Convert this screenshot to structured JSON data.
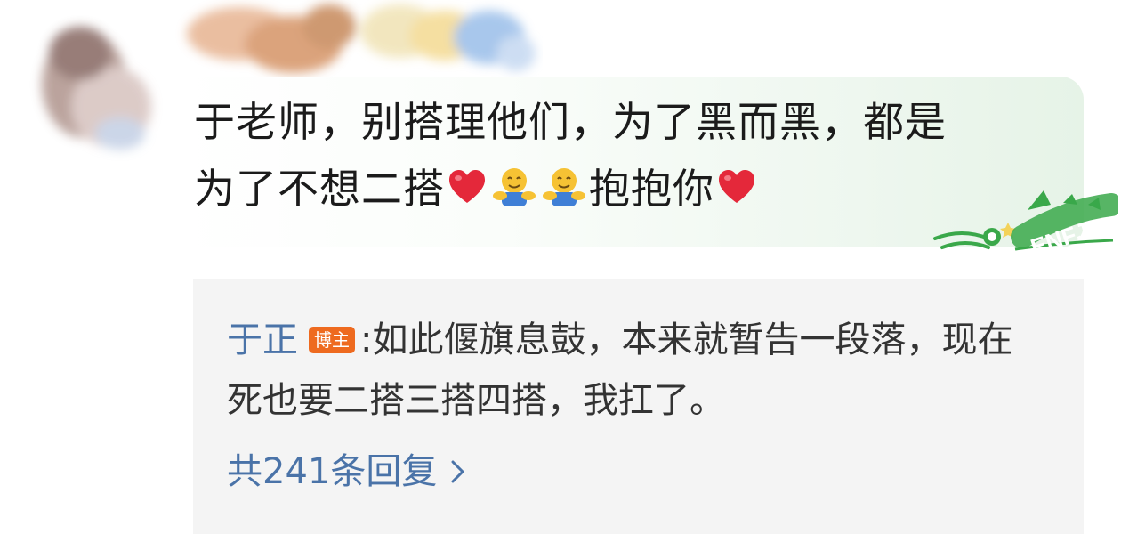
{
  "comment": {
    "line1": "于老师，别搭理他们，为了黑而黑，都是",
    "line2_prefix": "为了不想二搭",
    "line2_suffix": "抱抱你"
  },
  "badge": {
    "text": "ENFJ"
  },
  "reply": {
    "author": "于正",
    "author_tag": "博主",
    "separator": ":",
    "text": "如此偃旗息鼓，本来就暂告一段落，现在死也要二搭三搭四搭，我扛了。"
  },
  "reply_count": {
    "label": "共241条回复"
  },
  "colors": {
    "link_blue": "#4a73a8",
    "tag_orange": "#ee6a1f",
    "heart_red": "#e4283a",
    "hug_yellow": "#f6c234",
    "hug_blue": "#3f7fd6",
    "badge_green": "#3aa84a"
  },
  "icons": [
    "heart-emoji",
    "hug-emoji",
    "hug-emoji",
    "heart-emoji",
    "chevron-right-icon"
  ]
}
